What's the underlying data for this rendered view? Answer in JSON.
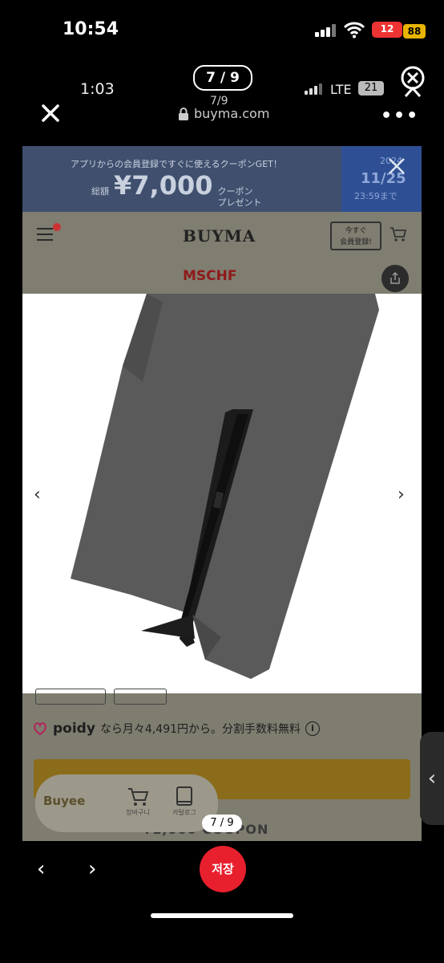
{
  "status_bar": {
    "time": "10:54",
    "battery": "12",
    "badge": "88"
  },
  "inner_status_bar": {
    "time": "1:03",
    "network": "LTE",
    "battery": "21"
  },
  "viewer": {
    "page_counter": "7 / 9",
    "page_counter_bottom": "7 / 9",
    "save_label": "저장"
  },
  "browser": {
    "page_indicator": "7/9",
    "url": "buyma.com",
    "more": "•••"
  },
  "banner": {
    "line1": "アプリからの会員登録ですぐに使えるクーポンGET！",
    "prefix": "総額",
    "amount": "¥7,000",
    "suffix_line1": "クーポン",
    "suffix_line2": "プレゼント",
    "date_year": "2024",
    "date": "11/25",
    "date_until": "23:59まで"
  },
  "site_header": {
    "logo": "BUYMA",
    "signup_line1": "今すぐ",
    "signup_line2": "会員登録!",
    "brand": "MSCHF"
  },
  "gallery": {
    "prev": "‹",
    "next": "›"
  },
  "payment": {
    "brand": "poidy",
    "text": "なら月々4,491円から。分割手数料無料",
    "info": "i"
  },
  "coupon_text": "¥1,000 COUPON",
  "buyee": {
    "logo": "Buyee",
    "cart_label": "장바구니",
    "book_label": "카탈로그"
  },
  "edge_arrow": "‹",
  "colors": {
    "save": "#e8202e",
    "banner": "#3f4f6d",
    "banner_date": "#2e4f93"
  }
}
